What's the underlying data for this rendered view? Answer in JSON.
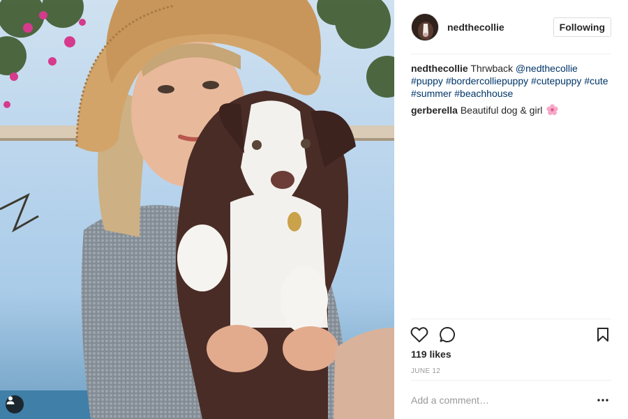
{
  "photo": {
    "alt_subject": "woman-in-straw-hat-holding-border-collie-puppy",
    "tag_icon": "user-tag-icon"
  },
  "header": {
    "username": "nedthecollie",
    "follow_label": "Following",
    "avatar_icon": "profile-avatar"
  },
  "comments": [
    {
      "user": "nedthecollie",
      "text": "Thrwback",
      "mention": "@nedthecollie",
      "hashtags": [
        "#puppy",
        "#bordercolliepuppy",
        "#cutepuppy",
        "#cute",
        "#summer",
        "#beachhouse"
      ]
    },
    {
      "user": "gerberella",
      "text": "Beautiful dog & girl",
      "emoji": "cherry-blossom-icon"
    }
  ],
  "actions": {
    "like_icon": "heart-icon",
    "comment_icon": "speech-bubble-icon",
    "save_icon": "bookmark-icon"
  },
  "likes": "119 likes",
  "date": "JUNE 12",
  "add_comment": {
    "placeholder": "Add a comment…",
    "more_icon": "more-options-icon"
  },
  "colors": {
    "link": "#003569",
    "text": "#262626",
    "muted": "#999999",
    "border": "#efefef"
  }
}
